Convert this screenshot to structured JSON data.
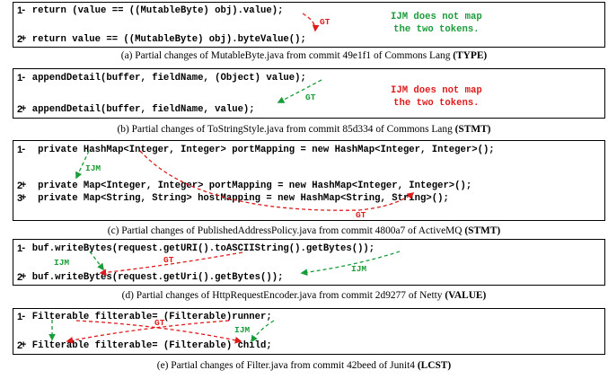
{
  "panels": [
    {
      "lines": [
        {
          "num": "1",
          "text": "- return (value == ((MutableByte) obj).value);"
        },
        {
          "num": "2",
          "text": "+ return value == ((MutableByte) obj).byteValue();"
        }
      ],
      "note": "IJM does not map\nthe two tokens.",
      "labels": [
        "GT"
      ],
      "caption_text": "(a) Partial changes of MutableByte.java from commit 49e1f1 of Commons Lang ",
      "caption_bold": "(TYPE)"
    },
    {
      "lines": [
        {
          "num": "1",
          "text": "- appendDetail(buffer, fieldName, (Object) value);"
        },
        {
          "num": "2",
          "text": "+ appendDetail(buffer, fieldName, value);"
        }
      ],
      "note": "IJM does not map\nthe two tokens.",
      "labels": [
        "GT"
      ],
      "caption_text": "(b) Partial changes of ToStringStyle.java from commit 85d334 of Commons Lang ",
      "caption_bold": "(STMT)"
    },
    {
      "lines": [
        {
          "num": "1",
          "text": "-  private HashMap<Integer, Integer> portMapping = new HashMap<Integer, Integer>();"
        },
        {
          "num": "2",
          "text": "+  private Map<Integer, Integer> portMapping = new HashMap<Integer, Integer>();"
        },
        {
          "num": "3",
          "text": "+  private Map<String, String> hostMapping = new HashMap<String, String>();"
        }
      ],
      "labels": [
        "IJM",
        "GT"
      ],
      "caption_text": "(c) Partial changes of PublishedAddressPolicy.java from commit 4800a7 of ActiveMQ ",
      "caption_bold": "(STMT)"
    },
    {
      "lines": [
        {
          "num": "1",
          "text": "- buf.writeBytes(request.getURI().toASCIIString().getBytes());"
        },
        {
          "num": "2",
          "text": "+ buf.writeBytes(request.getUri().getBytes());"
        }
      ],
      "labels": [
        "IJM",
        "GT",
        "IJM"
      ],
      "caption_text": "(d) Partial changes of HttpRequestEncoder.java from commit 2d9277 of Netty ",
      "caption_bold": "(VALUE)"
    },
    {
      "lines": [
        {
          "num": "1",
          "text": "- Filterable filterable= (Filterable)runner;"
        },
        {
          "num": "2",
          "text": "+ Filterable filterable= (Filterable) child;"
        }
      ],
      "labels": [
        "GT",
        "IJM"
      ],
      "caption_text": "(e) Partial changes of Filter.java from commit 42beed of Junit4 ",
      "caption_bold": "(LCST)"
    }
  ],
  "colors": {
    "ijm": "#1a9c3a",
    "gt": "#e01b1b"
  }
}
